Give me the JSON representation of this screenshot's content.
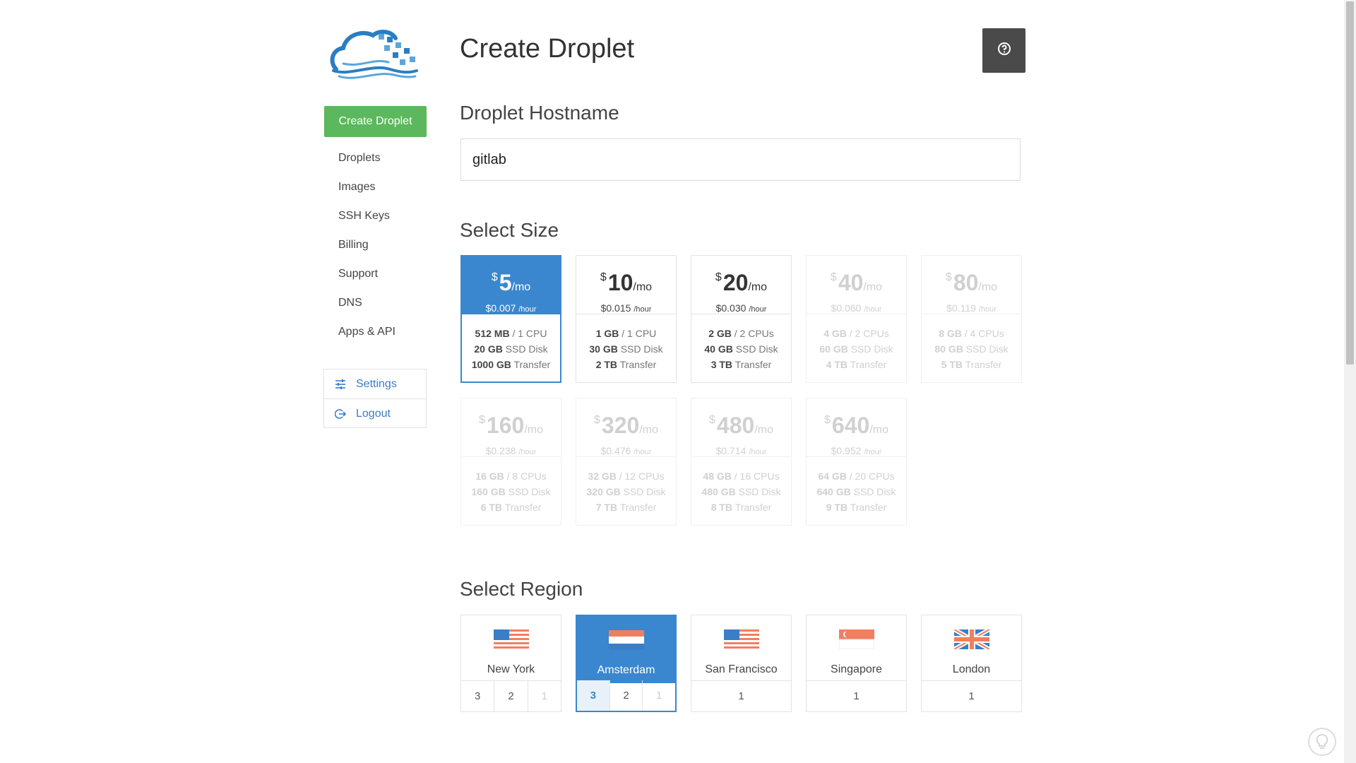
{
  "sidebar": {
    "create_label": "Create Droplet",
    "nav": [
      "Droplets",
      "Images",
      "SSH Keys",
      "Billing",
      "Support",
      "DNS",
      "Apps & API"
    ],
    "account": {
      "settings_label": "Settings",
      "logout_label": "Logout"
    }
  },
  "main": {
    "title": "Create Droplet",
    "hostname_heading": "Droplet Hostname",
    "hostname_value": "gitlab",
    "size_heading": "Select Size",
    "region_heading": "Select Region"
  },
  "colors": {
    "accent": "#3a87cf",
    "green": "#5cb85c",
    "help_bg": "#4a4a4a"
  },
  "sizes": [
    {
      "currency": "$",
      "price": "5",
      "per": "/mo",
      "hourly": "$0.007",
      "hourly_unit": "/hour",
      "mem": "512 MB",
      "cpu": "/ 1 CPU",
      "disk": "20 GB",
      "disk_label": "SSD Disk",
      "transfer": "1000 GB",
      "transfer_label": "Transfer",
      "state": "selected"
    },
    {
      "currency": "$",
      "price": "10",
      "per": "/mo",
      "hourly": "$0.015",
      "hourly_unit": "/hour",
      "mem": "1 GB",
      "cpu": "/ 1 CPU",
      "disk": "30 GB",
      "disk_label": "SSD Disk",
      "transfer": "2 TB",
      "transfer_label": "Transfer",
      "state": "available"
    },
    {
      "currency": "$",
      "price": "20",
      "per": "/mo",
      "hourly": "$0.030",
      "hourly_unit": "/hour",
      "mem": "2 GB",
      "cpu": "/ 2 CPUs",
      "disk": "40 GB",
      "disk_label": "SSD Disk",
      "transfer": "3 TB",
      "transfer_label": "Transfer",
      "state": "available"
    },
    {
      "currency": "$",
      "price": "40",
      "per": "/mo",
      "hourly": "$0.060",
      "hourly_unit": "/hour",
      "mem": "4 GB",
      "cpu": "/ 2 CPUs",
      "disk": "60 GB",
      "disk_label": "SSD Disk",
      "transfer": "4 TB",
      "transfer_label": "Transfer",
      "state": "disabled"
    },
    {
      "currency": "$",
      "price": "80",
      "per": "/mo",
      "hourly": "$0.119",
      "hourly_unit": "/hour",
      "mem": "8 GB",
      "cpu": "/ 4 CPUs",
      "disk": "80 GB",
      "disk_label": "SSD Disk",
      "transfer": "5 TB",
      "transfer_label": "Transfer",
      "state": "disabled"
    },
    {
      "currency": "$",
      "price": "160",
      "per": "/mo",
      "hourly": "$0.238",
      "hourly_unit": "/hour",
      "mem": "16 GB",
      "cpu": "/ 8 CPUs",
      "disk": "160 GB",
      "disk_label": "SSD Disk",
      "transfer": "6 TB",
      "transfer_label": "Transfer",
      "state": "disabled"
    },
    {
      "currency": "$",
      "price": "320",
      "per": "/mo",
      "hourly": "$0.476",
      "hourly_unit": "/hour",
      "mem": "32 GB",
      "cpu": "/ 12 CPUs",
      "disk": "320 GB",
      "disk_label": "SSD Disk",
      "transfer": "7 TB",
      "transfer_label": "Transfer",
      "state": "disabled"
    },
    {
      "currency": "$",
      "price": "480",
      "per": "/mo",
      "hourly": "$0.714",
      "hourly_unit": "/hour",
      "mem": "48 GB",
      "cpu": "/ 16 CPUs",
      "disk": "480 GB",
      "disk_label": "SSD Disk",
      "transfer": "8 TB",
      "transfer_label": "Transfer",
      "state": "disabled"
    },
    {
      "currency": "$",
      "price": "640",
      "per": "/mo",
      "hourly": "$0.952",
      "hourly_unit": "/hour",
      "mem": "64 GB",
      "cpu": "/ 20 CPUs",
      "disk": "640 GB",
      "disk_label": "SSD Disk",
      "transfer": "9 TB",
      "transfer_label": "Transfer",
      "state": "disabled"
    }
  ],
  "regions": [
    {
      "name": "New York",
      "flag": "us-flag",
      "numbers": [
        {
          "n": "3",
          "state": "on"
        },
        {
          "n": "2",
          "state": "on"
        },
        {
          "n": "1",
          "state": "off"
        }
      ],
      "selected": false
    },
    {
      "name": "Amsterdam",
      "flag": "nl-flag",
      "numbers": [
        {
          "n": "3",
          "state": "active"
        },
        {
          "n": "2",
          "state": "on"
        },
        {
          "n": "1",
          "state": "off"
        }
      ],
      "selected": true
    },
    {
      "name": "San Francisco",
      "flag": "us-flag",
      "numbers": [
        {
          "n": "1",
          "state": "on"
        }
      ],
      "selected": false
    },
    {
      "name": "Singapore",
      "flag": "sg-flag",
      "numbers": [
        {
          "n": "1",
          "state": "on"
        }
      ],
      "selected": false
    },
    {
      "name": "London",
      "flag": "uk-flag",
      "numbers": [
        {
          "n": "1",
          "state": "on"
        }
      ],
      "selected": false
    }
  ]
}
